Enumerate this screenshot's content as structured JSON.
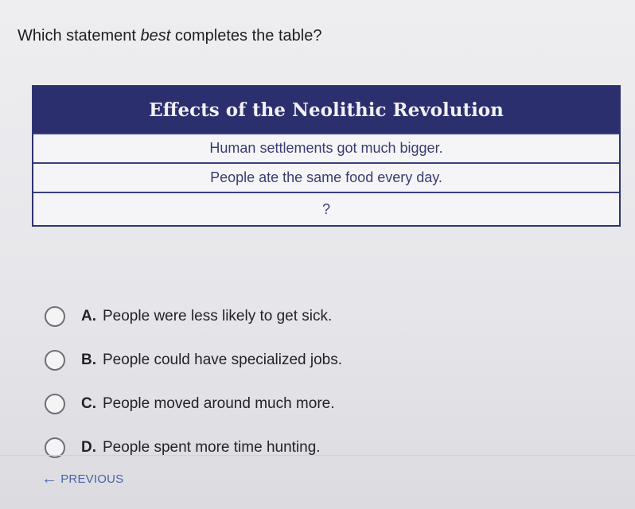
{
  "question": {
    "prefix": "Which statement ",
    "emphasis": "best",
    "suffix": " completes the table?"
  },
  "table": {
    "title": "Effects of the Neolithic Revolution",
    "rows": [
      "Human settlements got much bigger.",
      "People ate the same food every day.",
      "?"
    ]
  },
  "choices": [
    {
      "letter": "A.",
      "text": "People were less likely to get sick."
    },
    {
      "letter": "B.",
      "text": "People could have specialized jobs."
    },
    {
      "letter": "C.",
      "text": "People moved around much more."
    },
    {
      "letter": "D.",
      "text": "People spent more time hunting."
    }
  ],
  "nav": {
    "previous_label": "PREVIOUS",
    "previous_icon": "arrow-left-icon"
  }
}
